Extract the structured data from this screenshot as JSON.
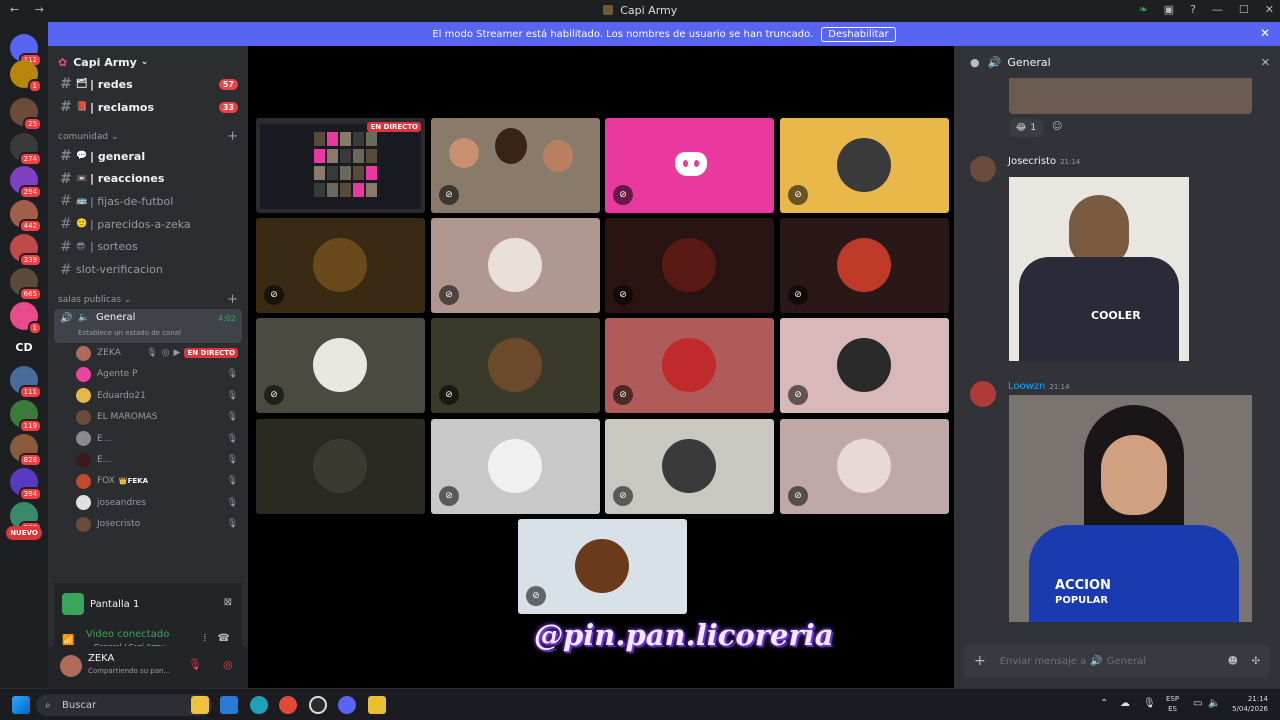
{
  "window": {
    "title": "Capi Army"
  },
  "banner": {
    "text": "El modo Streamer está habilitado. Los nombres de usuario se han truncado.",
    "button": "Deshabilitar"
  },
  "guilds": [
    {
      "label": "",
      "badge": "112",
      "color": "#5865f2"
    },
    {
      "label": "",
      "badge": "1",
      "color": "#b8860b"
    },
    {
      "label": "",
      "badge": "25",
      "color": "#6b4a3a"
    },
    {
      "label": "",
      "badge": "274",
      "color": "#3a3a3a"
    },
    {
      "label": "",
      "badge": "294",
      "color": "#7e3fc0"
    },
    {
      "label": "",
      "badge": "442",
      "color": "#a35e4a"
    },
    {
      "label": "",
      "badge": "339",
      "color": "#c04a4a"
    },
    {
      "label": "",
      "badge": "665",
      "color": "#5a4a3a"
    },
    {
      "label": "",
      "badge": "1",
      "color": "#e94b8a"
    },
    {
      "label": "CD",
      "badge": "",
      "color": "#1e1f22"
    },
    {
      "label": "",
      "badge": "111",
      "color": "#4a6a9a"
    },
    {
      "label": "",
      "badge": "119",
      "color": "#3a7a3a"
    },
    {
      "label": "",
      "badge": "828",
      "color": "#8a5a3a"
    },
    {
      "label": "",
      "badge": "394",
      "color": "#5a3ac0"
    },
    {
      "label": "",
      "badge": "558",
      "color": "#3a8a6a"
    },
    {
      "label": "NUEVO",
      "badge": "",
      "color": "#da373c"
    }
  ],
  "server": {
    "name": "Capi Army"
  },
  "channels": {
    "top": [
      {
        "name": "| redes",
        "badge": "57",
        "unread": true,
        "icon": "🗂"
      },
      {
        "name": "| reclamos",
        "badge": "33",
        "unread": true,
        "icon": "📕"
      }
    ],
    "category1": "comunidad",
    "comunidad": [
      {
        "name": "| general",
        "unread": true,
        "icon": "💬"
      },
      {
        "name": "| reacciones",
        "unread": true,
        "icon": "📼"
      },
      {
        "name": "| fijas-de-futbol",
        "unread": false,
        "icon": "🚌"
      },
      {
        "name": "| parecidos-a-zeka",
        "unread": false,
        "icon": "🙂"
      },
      {
        "name": "| sorteos",
        "unread": false,
        "icon": "😎"
      },
      {
        "name": "slot-verificacion",
        "unread": false,
        "icon": ""
      }
    ],
    "category2": "salas publicas",
    "voice": {
      "name": "General",
      "time": "4:02",
      "status": "Establece un estado de canal"
    },
    "voice_users": [
      {
        "name": "ZEKA",
        "live": "EN DIRECTO",
        "color": "#b06a5a"
      },
      {
        "name": "Agente P",
        "color": "#eb459e"
      },
      {
        "name": "Eduardo21",
        "color": "#e6b84a"
      },
      {
        "name": "EL MAROMAS",
        "color": "#6a4a3a"
      },
      {
        "name": "E...",
        "color": "#8a8a8a"
      },
      {
        "name": "E...",
        "color": "#3a1a1a"
      },
      {
        "name": "FOX",
        "tag": "FEKA",
        "color": "#c04a2a"
      },
      {
        "name": "joseandres",
        "color": "#e0e0e0"
      },
      {
        "name": "Josecristo",
        "color": "#6a4a3a"
      }
    ]
  },
  "panel": {
    "title": "Pantalla 1",
    "status": "Video conectado",
    "location": "General / Capi Army",
    "user": "ZEKA",
    "user_status": "Compartiendo su pan..."
  },
  "tiles": [
    {
      "color": "#2a2a30",
      "kind": "screen",
      "live": "EN DIRECTO"
    },
    {
      "color": "#8a7a6a",
      "kind": "camera"
    },
    {
      "color": "#e9389e",
      "kind": "discord"
    },
    {
      "color": "#e8b84a",
      "kind": "avatar",
      "av": "#3a3a3a"
    },
    {
      "color": "#3a2a14",
      "kind": "avatar",
      "av": "#6a4a1a"
    },
    {
      "color": "#b09890",
      "kind": "avatar",
      "av": "#e8e0d8"
    },
    {
      "color": "#2a1412",
      "kind": "avatar",
      "av": "#5a1a14"
    },
    {
      "color": "#2a1818",
      "kind": "avatar",
      "av": "#c03a2a"
    },
    {
      "color": "#4a4a40",
      "kind": "avatar",
      "av": "#e8e8e0"
    },
    {
      "color": "#3a3a2a",
      "kind": "avatar",
      "av": "#6a4a2a"
    },
    {
      "color": "#b05a5a",
      "kind": "avatar",
      "av": "#c02a2a"
    },
    {
      "color": "#d8b8b8",
      "kind": "avatar",
      "av": "#2a2a2a"
    },
    {
      "color": "#2a2a22",
      "kind": "avatar",
      "av": "#3a3a30"
    },
    {
      "color": "#c8c8c8",
      "kind": "avatar",
      "av": "#f0f0f0"
    },
    {
      "color": "#c8c8c0",
      "kind": "avatar",
      "av": "#3a3a3a"
    },
    {
      "color": "#c0a8a8",
      "kind": "avatar",
      "av": "#e8d8d8"
    },
    {
      "color": "#d8e0e8",
      "kind": "avatar",
      "av": "#6a3a1a"
    }
  ],
  "watermark": "@pin.pan.licoreria",
  "chat": {
    "title": "General",
    "reaction_count": "1",
    "messages": [
      {
        "author": "Josecristo",
        "time": "21:14",
        "color": "#f2f3f5"
      },
      {
        "author": "Loowzn",
        "time": "21:14",
        "color": "#00a8fc"
      }
    ],
    "image_text": [
      "COOLER",
      "ACCION",
      "POPULAR"
    ],
    "input_placeholder": "Enviar mensaje a",
    "input_channel": "General"
  },
  "taskbar": {
    "search": "Buscar",
    "lang1": "ESP",
    "lang2": "ES",
    "time": "21:14",
    "date": "5/04/2026"
  }
}
